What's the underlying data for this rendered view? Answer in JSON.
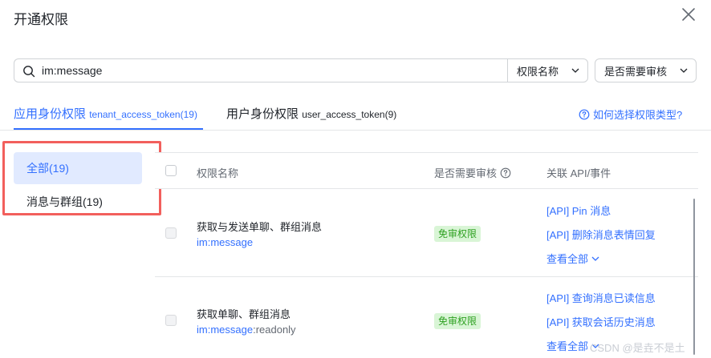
{
  "dialog": {
    "title": "开通权限"
  },
  "search": {
    "value": "im:message",
    "field_select": "权限名称",
    "review_select": "是否需要审核"
  },
  "tabs": [
    {
      "label": "应用身份权限",
      "sub": "tenant_access_token(19)"
    },
    {
      "label": "用户身份权限",
      "sub": "user_access_token(9)"
    }
  ],
  "help_link": "如何选择权限类型?",
  "sidebar": {
    "items": [
      {
        "label": "全部(19)"
      },
      {
        "label": "消息与群组(19)"
      }
    ]
  },
  "table": {
    "headers": {
      "name": "权限名称",
      "review": "是否需要审核",
      "api": "关联 API/事件"
    },
    "rows": [
      {
        "name": "获取与发送单聊、群组消息",
        "code_hl": "im:message",
        "code_rest": "",
        "badge": "免审权限",
        "apis": [
          "[API] Pin 消息",
          "[API] 删除消息表情回复"
        ],
        "view_all": "查看全部"
      },
      {
        "name": "获取单聊、群组消息",
        "code_hl": "im:message",
        "code_rest": ":readonly",
        "badge": "免审权限",
        "apis": [
          "[API] 查询消息已读信息",
          "[API] 获取会话历史消息"
        ],
        "view_all": "查看全部"
      }
    ]
  },
  "watermark": "CSDN @是垚不是土",
  "colors": {
    "accent": "#3370ff",
    "badge_bg": "#d9f5d6",
    "badge_text": "#2ea121",
    "highlight_box": "#f25f5c"
  }
}
